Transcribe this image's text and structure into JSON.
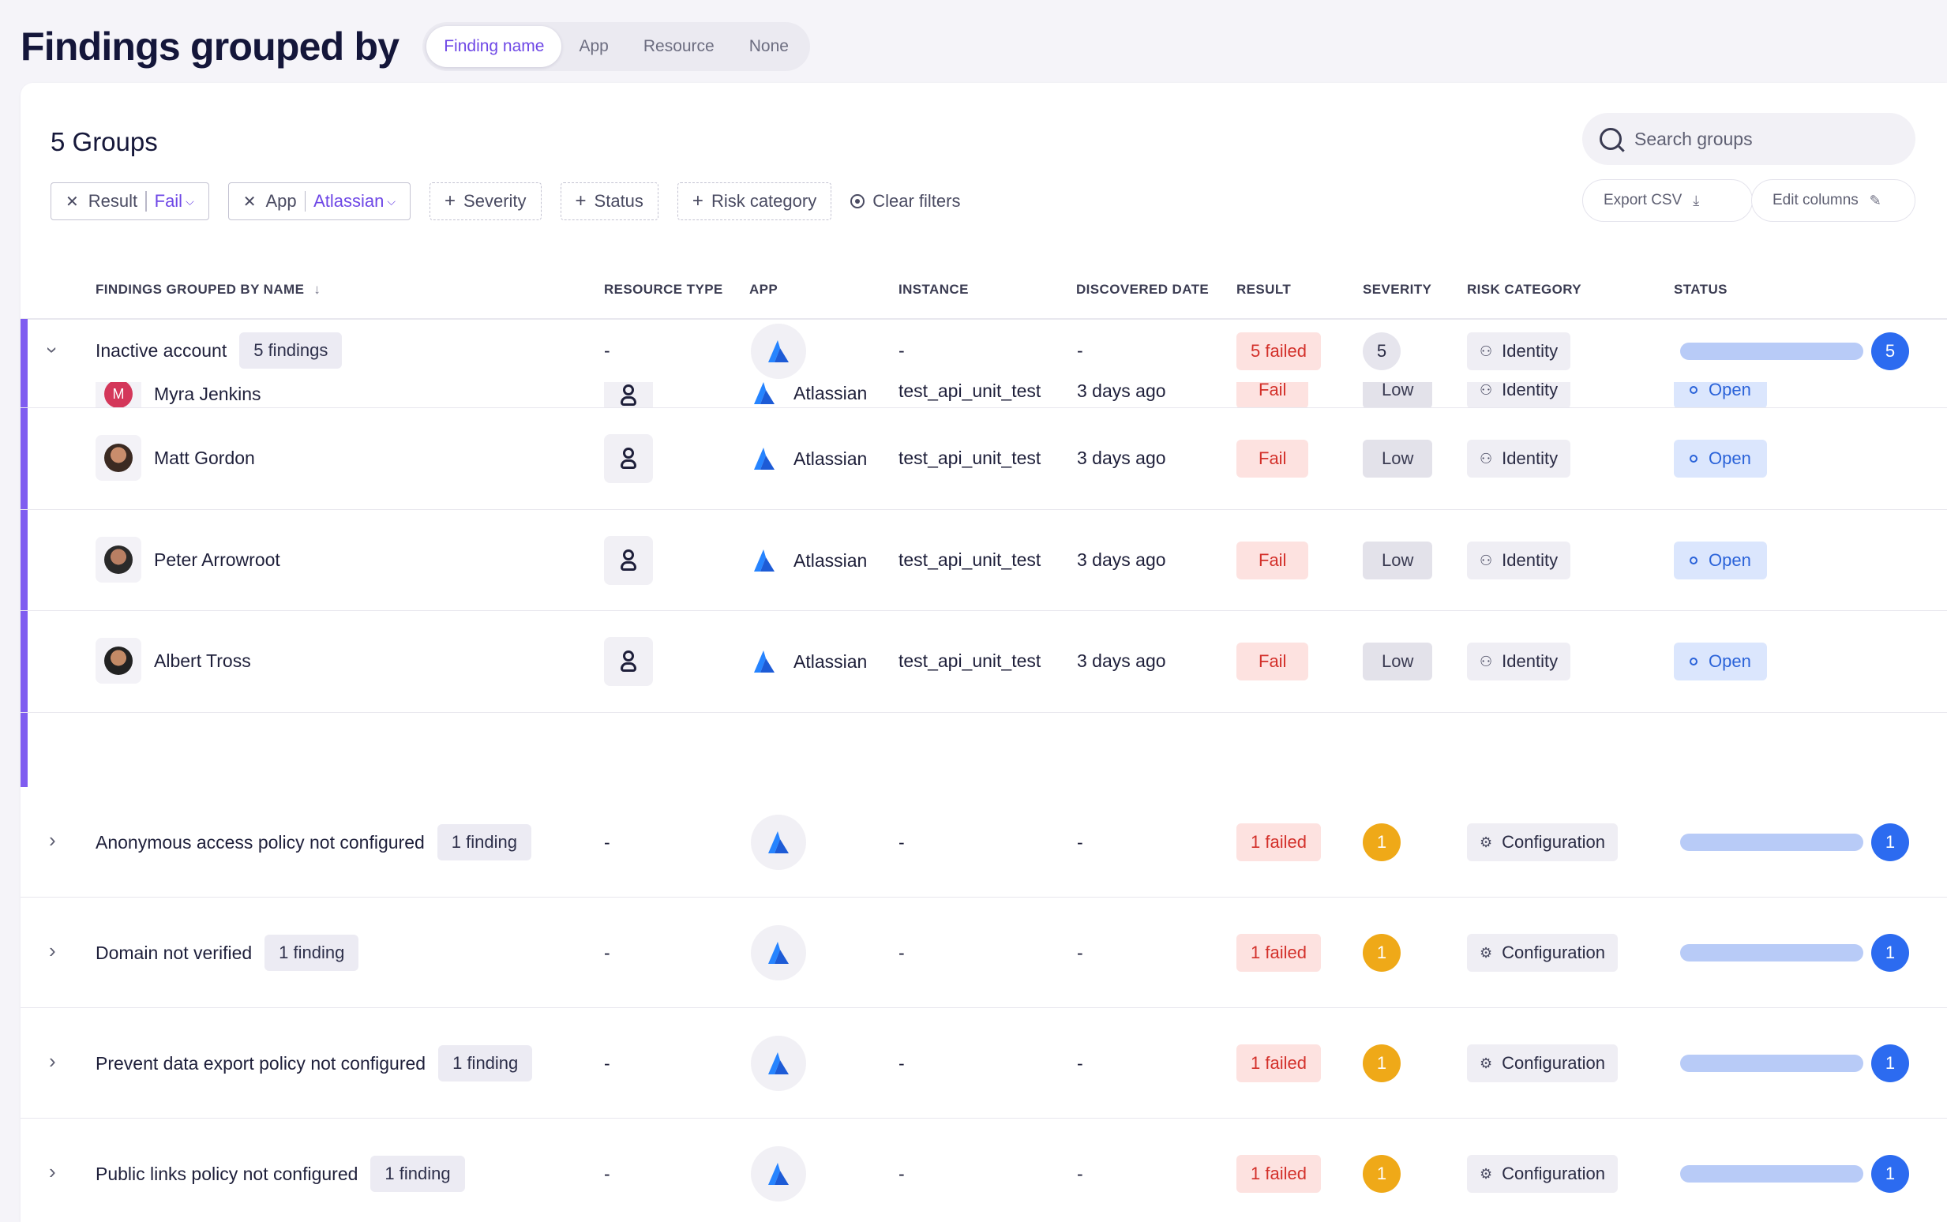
{
  "page": {
    "title": "Findings grouped by",
    "group_by_options": [
      "Finding name",
      "App",
      "Resource",
      "None"
    ],
    "group_by_selected": "Finding name"
  },
  "toolbar": {
    "groups_count": "5 Groups",
    "search_placeholder": "Search groups",
    "filters": {
      "result_label": "Result",
      "result_value": "Fail",
      "app_label": "App",
      "app_value": "Atlassian",
      "add_severity": "Severity",
      "add_status": "Status",
      "add_risk_category": "Risk category",
      "clear": "Clear filters"
    },
    "export_csv": "Export CSV",
    "edit_columns": "Edit columns"
  },
  "columns": [
    "FINDINGS GROUPED BY NAME",
    "RESOURCE TYPE",
    "APP",
    "INSTANCE",
    "DISCOVERED DATE",
    "RESULT",
    "SEVERITY",
    "RISK CATEGORY",
    "STATUS"
  ],
  "groups": [
    {
      "name": "Inactive account",
      "count_label": "5 findings",
      "resource_type": "-",
      "instance": "-",
      "date": "-",
      "result": "5 failed",
      "severity": "5",
      "risk_category": "Identity",
      "status_count": "5",
      "expanded": true,
      "findings": [
        {
          "name": "Myra Jenkins",
          "avatar_initial": "M",
          "app": "Atlassian",
          "instance": "test_api_unit_test",
          "date": "3 days ago",
          "result": "Fail",
          "severity": "Low",
          "risk_category": "Identity",
          "status": "Open"
        },
        {
          "name": "Matt Gordon",
          "app": "Atlassian",
          "instance": "test_api_unit_test",
          "date": "3 days ago",
          "result": "Fail",
          "severity": "Low",
          "risk_category": "Identity",
          "status": "Open"
        },
        {
          "name": "Peter Arrowroot",
          "app": "Atlassian",
          "instance": "test_api_unit_test",
          "date": "3 days ago",
          "result": "Fail",
          "severity": "Low",
          "risk_category": "Identity",
          "status": "Open"
        },
        {
          "name": "Albert Tross",
          "app": "Atlassian",
          "instance": "test_api_unit_test",
          "date": "3 days ago",
          "result": "Fail",
          "severity": "Low",
          "risk_category": "Identity",
          "status": "Open"
        }
      ]
    },
    {
      "name": "Anonymous access policy not configured",
      "count_label": "1 finding",
      "resource_type": "-",
      "instance": "-",
      "date": "-",
      "result": "1 failed",
      "severity": "1",
      "risk_category": "Configuration",
      "status_count": "1"
    },
    {
      "name": "Domain not verified",
      "count_label": "1 finding",
      "resource_type": "-",
      "instance": "-",
      "date": "-",
      "result": "1 failed",
      "severity": "1",
      "risk_category": "Configuration",
      "status_count": "1"
    },
    {
      "name": "Prevent data export policy not configured",
      "count_label": "1 finding",
      "resource_type": "-",
      "instance": "-",
      "date": "-",
      "result": "1 failed",
      "severity": "1",
      "risk_category": "Configuration",
      "status_count": "1"
    },
    {
      "name": "Public links policy not configured",
      "count_label": "1 finding",
      "resource_type": "-",
      "instance": "-",
      "date": "-",
      "result": "1 failed",
      "severity": "1",
      "risk_category": "Configuration",
      "status_count": "1"
    }
  ],
  "colors": {
    "accent": "#6e47e6",
    "fail_bg": "#fde2e0",
    "fail_text": "#d3302a",
    "severity_medium": "#efa918",
    "status_blue": "#2c6bf0",
    "atlassian_blue": "#2684ff"
  },
  "icons": {
    "search": "search-icon",
    "close": "close-icon",
    "plus": "plus-icon",
    "clear": "clear-filter-icon",
    "download": "download-icon",
    "edit": "pencil-icon",
    "sort": "arrow-down-icon",
    "expand": "chevron-right-icon",
    "collapse": "chevron-down-icon",
    "app": "atlassian-logo-icon",
    "identity": "person-icon",
    "configuration": "gear-icon",
    "resource_user": "user-resource-icon",
    "open": "circle-icon"
  }
}
